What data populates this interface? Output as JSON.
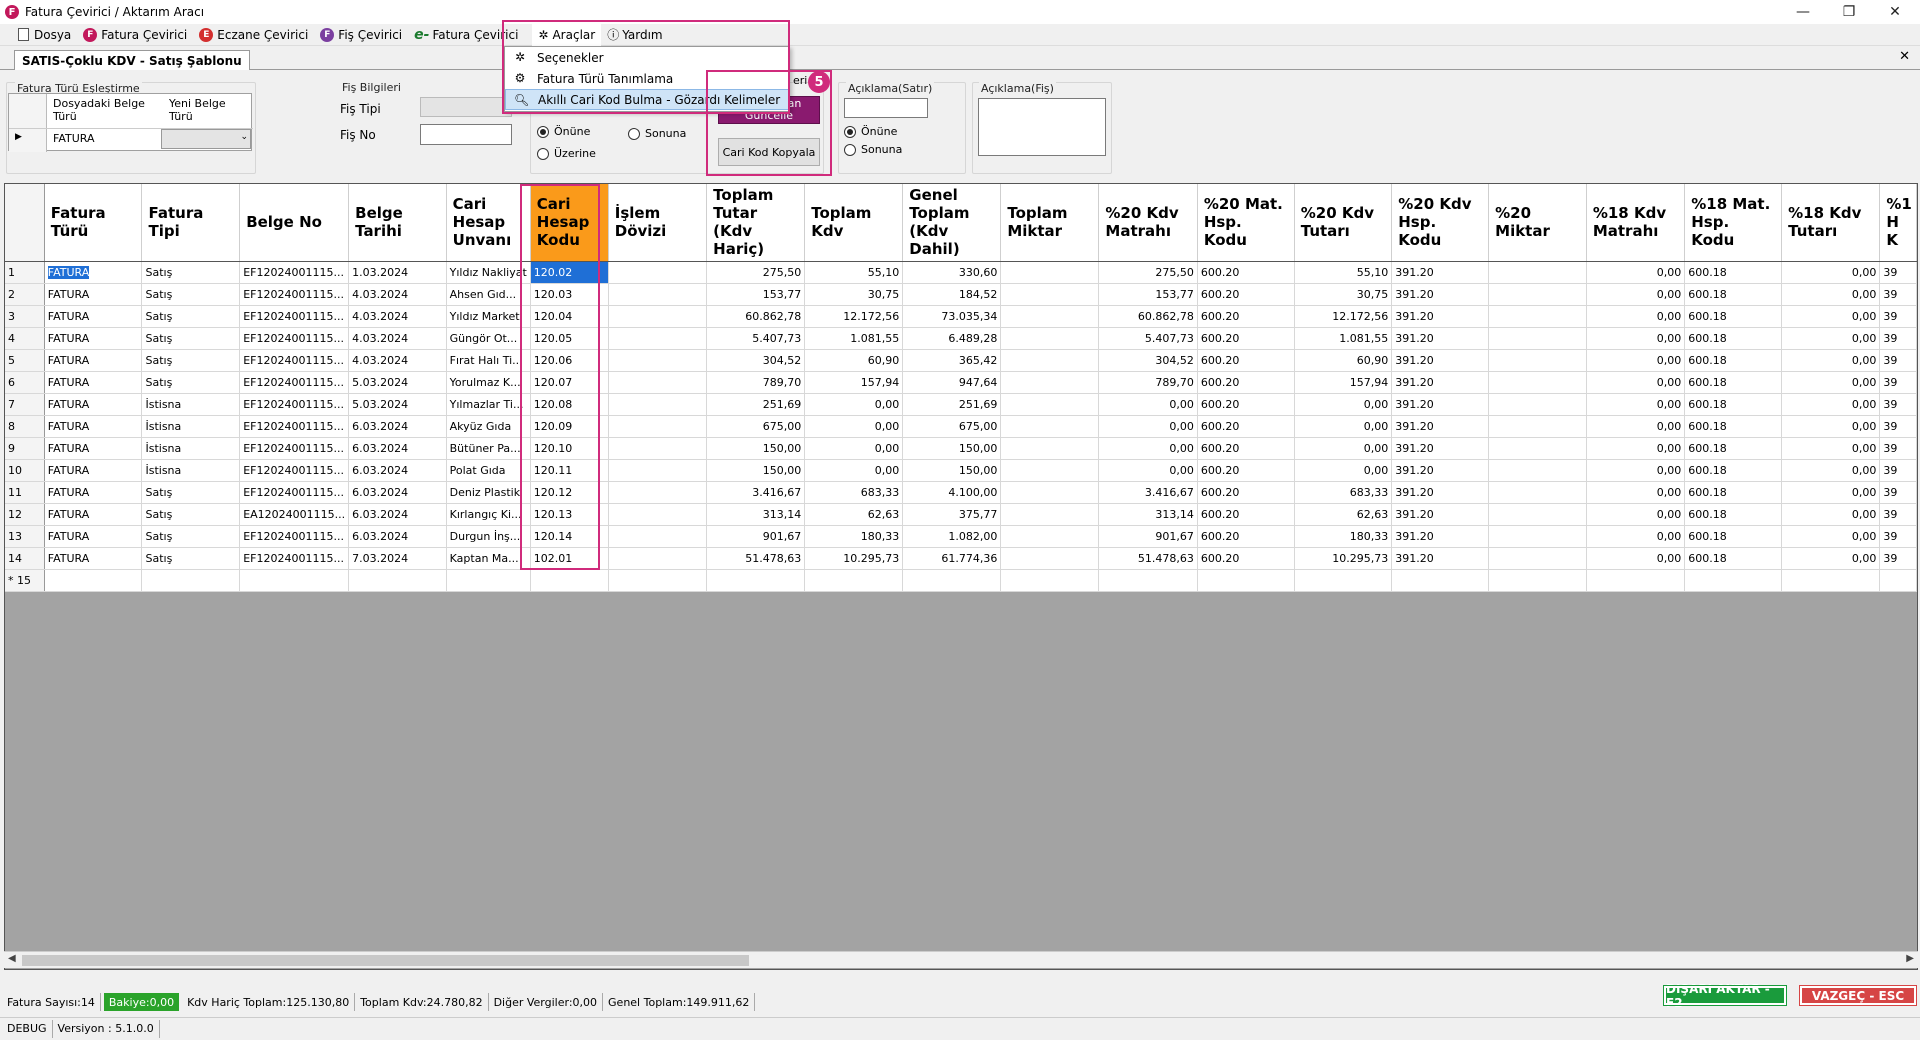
{
  "window": {
    "title": "Fatura Çevirici / Aktarım Aracı",
    "app_icon_letter": "F",
    "minimize": "—",
    "maximize": "❐",
    "close": "✕"
  },
  "menu": {
    "dosya": "Dosya",
    "fatura_cevirici": "Fatura Çevirici",
    "eczane_cevirici": "Eczane Çevirici",
    "fis_cevirici": "Fiş Çevirici",
    "efatura_cevirici": "Fatura Çevirici",
    "araclar": "Araçlar",
    "yardim": "Yardım",
    "badge_f": "F",
    "badge_e": "E",
    "e_glyph": "e-"
  },
  "dropdown": {
    "items": [
      {
        "label": "Seçenekler",
        "icon": "tools-icon"
      },
      {
        "label": "Fatura Türü Tanımlama",
        "icon": "gear-doc-icon"
      },
      {
        "label": "Akıllı Cari Kod Bulma - Gözardı Kelimeler",
        "icon": "search-icon"
      }
    ]
  },
  "step_badge": "5",
  "tab": {
    "label": "SATIS-Çoklu KDV - Satış Şablonu",
    "close": "✕"
  },
  "config": {
    "mapping_title": "Fatura Türü Eşleştirme",
    "map_col1": "Dosyadaki Belge Türü",
    "map_col2": "Yeni Belge Türü",
    "map_value": "FATURA",
    "fis_title": "Fiş Bilgileri",
    "fis_tipi": "Fiş Tipi",
    "fis_no": "Fiş No",
    "onune": "Önüne",
    "sonuna": "Sonuna",
    "uzerine": "Üzerine",
    "cari_title_partial": "eri",
    "btn_update": "...dan Güncelle",
    "btn_update_l1": "dan",
    "btn_update_l2": "Güncelle",
    "btn_copy": "Cari Kod Kopyala",
    "aciklama_satir": "Açıklama(Satır)",
    "aciklama_fis": "Açıklama(Fiş)",
    "onune2": "Önüne",
    "sonuna2": "Sonuna"
  },
  "grid": {
    "columns": [
      "Fatura Türü",
      "Fatura Tipi",
      "Belge No",
      "Belge Tarihi",
      "Cari Hesap Unvanı",
      "Cari Hesap Kodu",
      "İşlem Dövizi",
      "Toplam Tutar (Kdv Hariç)",
      "Toplam Kdv",
      "Genel Toplam (Kdv Dahil)",
      "Toplam Miktar",
      "%20 Kdv Matrahı",
      "%20 Mat. Hsp. Kodu",
      "%20 Kdv Tutarı",
      "%20 Kdv Hsp. Kodu",
      "%20 Miktar",
      "%18 Kdv Matrahı",
      "%18 Mat. Hsp. Kodu",
      "%18 Kdv Tutarı",
      "%1 H K"
    ],
    "rows": [
      [
        "1",
        "FATURA",
        "Satış",
        "EF12024001115...",
        "1.03.2024",
        "Yıldız Nakliyat",
        "120.02",
        "",
        "275,50",
        "55,10",
        "330,60",
        "",
        "275,50",
        "600.20",
        "55,10",
        "391.20",
        "",
        "0,00",
        "600.18",
        "0,00",
        "39"
      ],
      [
        "2",
        "FATURA",
        "Satış",
        "EF12024001115...",
        "4.03.2024",
        "Ahsen Gıd...",
        "120.03",
        "",
        "153,77",
        "30,75",
        "184,52",
        "",
        "153,77",
        "600.20",
        "30,75",
        "391.20",
        "",
        "0,00",
        "600.18",
        "0,00",
        "39"
      ],
      [
        "3",
        "FATURA",
        "Satış",
        "EF12024001115...",
        "4.03.2024",
        "Yıldız Market",
        "120.04",
        "",
        "60.862,78",
        "12.172,56",
        "73.035,34",
        "",
        "60.862,78",
        "600.20",
        "12.172,56",
        "391.20",
        "",
        "0,00",
        "600.18",
        "0,00",
        "39"
      ],
      [
        "4",
        "FATURA",
        "Satış",
        "EF12024001115...",
        "4.03.2024",
        "Güngör Ot...",
        "120.05",
        "",
        "5.407,73",
        "1.081,55",
        "6.489,28",
        "",
        "5.407,73",
        "600.20",
        "1.081,55",
        "391.20",
        "",
        "0,00",
        "600.18",
        "0,00",
        "39"
      ],
      [
        "5",
        "FATURA",
        "Satış",
        "EF12024001115...",
        "4.03.2024",
        "Fırat Halı Ti...",
        "120.06",
        "",
        "304,52",
        "60,90",
        "365,42",
        "",
        "304,52",
        "600.20",
        "60,90",
        "391.20",
        "",
        "0,00",
        "600.18",
        "0,00",
        "39"
      ],
      [
        "6",
        "FATURA",
        "Satış",
        "EF12024001115...",
        "5.03.2024",
        "Yorulmaz K...",
        "120.07",
        "",
        "789,70",
        "157,94",
        "947,64",
        "",
        "789,70",
        "600.20",
        "157,94",
        "391.20",
        "",
        "0,00",
        "600.18",
        "0,00",
        "39"
      ],
      [
        "7",
        "FATURA",
        "İstisna",
        "EF12024001115...",
        "5.03.2024",
        "Yılmazlar Ti...",
        "120.08",
        "",
        "251,69",
        "0,00",
        "251,69",
        "",
        "0,00",
        "600.20",
        "0,00",
        "391.20",
        "",
        "0,00",
        "600.18",
        "0,00",
        "39"
      ],
      [
        "8",
        "FATURA",
        "İstisna",
        "EF12024001115...",
        "6.03.2024",
        "Akyüz Gıda",
        "120.09",
        "",
        "675,00",
        "0,00",
        "675,00",
        "",
        "0,00",
        "600.20",
        "0,00",
        "391.20",
        "",
        "0,00",
        "600.18",
        "0,00",
        "39"
      ],
      [
        "9",
        "FATURA",
        "İstisna",
        "EF12024001115...",
        "6.03.2024",
        "Bütüner Pa...",
        "120.10",
        "",
        "150,00",
        "0,00",
        "150,00",
        "",
        "0,00",
        "600.20",
        "0,00",
        "391.20",
        "",
        "0,00",
        "600.18",
        "0,00",
        "39"
      ],
      [
        "10",
        "FATURA",
        "İstisna",
        "EF12024001115...",
        "6.03.2024",
        "Polat Gıda",
        "120.11",
        "",
        "150,00",
        "0,00",
        "150,00",
        "",
        "0,00",
        "600.20",
        "0,00",
        "391.20",
        "",
        "0,00",
        "600.18",
        "0,00",
        "39"
      ],
      [
        "11",
        "FATURA",
        "Satış",
        "EF12024001115...",
        "6.03.2024",
        "Deniz Plastik",
        "120.12",
        "",
        "3.416,67",
        "683,33",
        "4.100,00",
        "",
        "3.416,67",
        "600.20",
        "683,33",
        "391.20",
        "",
        "0,00",
        "600.18",
        "0,00",
        "39"
      ],
      [
        "12",
        "FATURA",
        "Satış",
        "EA12024001115...",
        "6.03.2024",
        "Kırlangıç Ki...",
        "120.13",
        "",
        "313,14",
        "62,63",
        "375,77",
        "",
        "313,14",
        "600.20",
        "62,63",
        "391.20",
        "",
        "0,00",
        "600.18",
        "0,00",
        "39"
      ],
      [
        "13",
        "FATURA",
        "Satış",
        "EF12024001115...",
        "6.03.2024",
        "Durgun İnş...",
        "120.14",
        "",
        "901,67",
        "180,33",
        "1.082,00",
        "",
        "901,67",
        "600.20",
        "180,33",
        "391.20",
        "",
        "0,00",
        "600.18",
        "0,00",
        "39"
      ],
      [
        "14",
        "FATURA",
        "Satış",
        "EF12024001115...",
        "7.03.2024",
        "Kaptan Ma...",
        "102.01",
        "",
        "51.478,63",
        "10.295,73",
        "61.774,36",
        "",
        "51.478,63",
        "600.20",
        "10.295,73",
        "391.20",
        "",
        "0,00",
        "600.18",
        "0,00",
        "39"
      ]
    ],
    "new_row_label": "* 15"
  },
  "status": {
    "fatura_sayisi": "Fatura Sayısı:14",
    "bakiye": "Bakiye:0,00",
    "kdv_haric": "Kdv Hariç Toplam:125.130,80",
    "toplam_kdv": "Toplam Kdv:24.780,82",
    "diger": "Diğer Vergiler:0,00",
    "genel": "Genel Toplam:149.911,62",
    "export": "DIŞARI AKTAR - F2",
    "cancel": "VAZGEÇ - ESC",
    "debug": "DEBUG",
    "version": "Versiyon : 5.1.0.0"
  },
  "colors": {
    "accent": "#d02b7c",
    "selected_header": "#fa9a1a",
    "selection": "#1f6fd6",
    "export": "#1a9b3c",
    "cancel": "#d64545",
    "update_btn": "#8a1a6f"
  }
}
